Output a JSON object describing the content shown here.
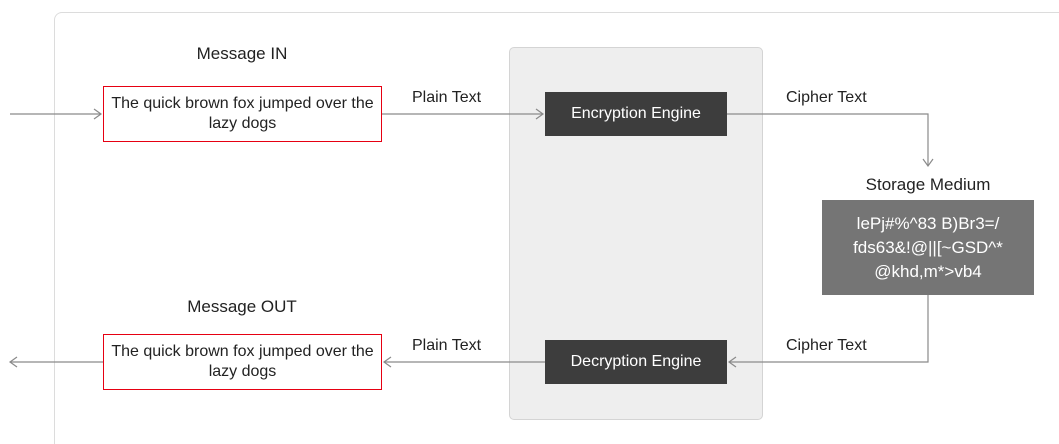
{
  "diagram": {
    "message_in": {
      "title": "Message IN",
      "text": "The quick brown fox jumped over the lazy dogs"
    },
    "message_out": {
      "title": "Message OUT",
      "text": "The quick brown fox jumped over the lazy dogs"
    },
    "encryption_engine": "Encryption Engine",
    "decryption_engine": "Decryption Engine",
    "storage": {
      "title": "Storage Medium",
      "content": "lePj#%^83 B)Br3=/\nfds63&!@||[~GSD^*\n@khd,m*>vb4"
    },
    "edge_labels": {
      "plain_in": "Plain Text",
      "cipher_out": "Cipher Text",
      "cipher_in": "Cipher Text",
      "plain_out": "Plain Text"
    },
    "colors": {
      "message_border": "#e60012",
      "engine_fill": "#3d3d3d",
      "storage_fill": "#757575",
      "panel_fill": "#eeeeee",
      "arrow": "#8a8a8a"
    }
  }
}
